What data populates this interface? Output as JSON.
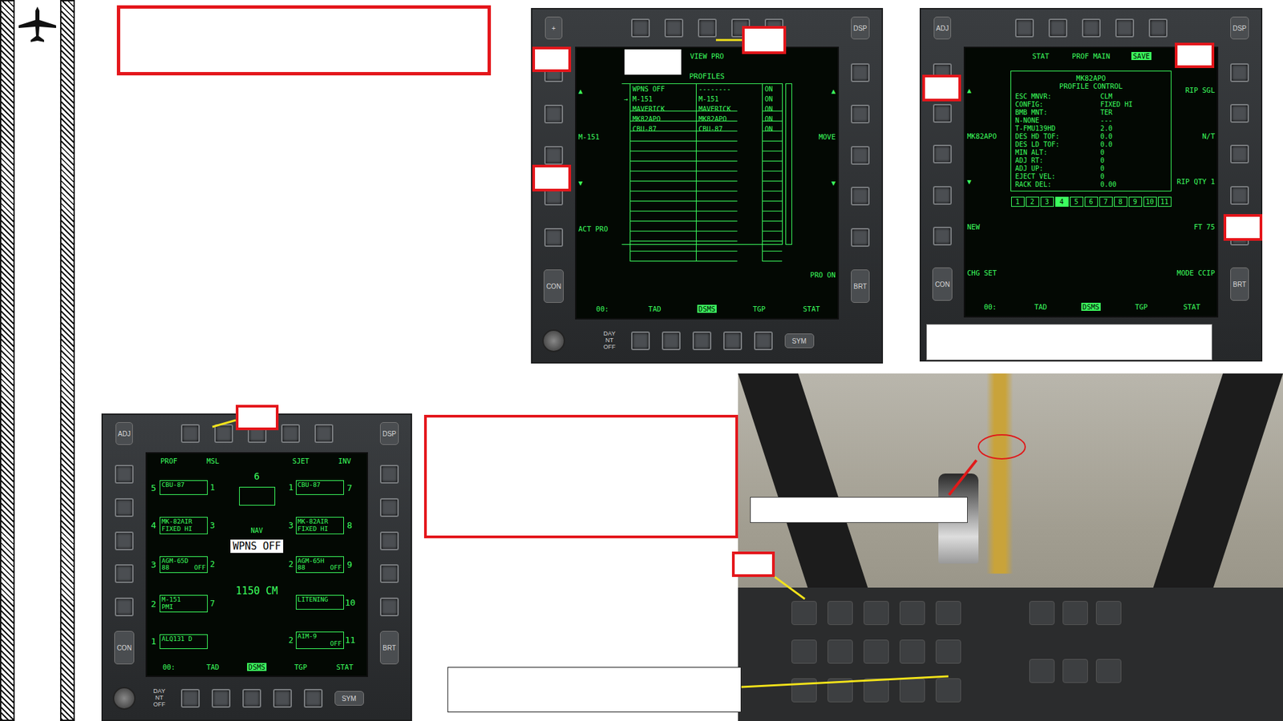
{
  "profiles_page": {
    "bezel": {
      "adj": "+",
      "dsp": "DSP",
      "con": "CON",
      "brt": "BRT",
      "day": "DAY NT OFF",
      "sym": "SYM"
    },
    "top": [
      {
        "text": "",
        "selected": false
      },
      {
        "text": "",
        "selected": false
      },
      {
        "text": "VIEW PRO",
        "selected": false
      },
      {
        "text": "",
        "selected": false
      },
      {
        "text": "",
        "selected": false
      }
    ],
    "left": [
      "▲",
      "M-151",
      "▼",
      "ACT PRO",
      ""
    ],
    "right": [
      "▲",
      "MOVE",
      "▼",
      "",
      "PRO ON"
    ],
    "bottom": [
      {
        "text": "00:",
        "selected": false
      },
      {
        "text": "TAD",
        "selected": false
      },
      {
        "text": "DSMS",
        "selected": true
      },
      {
        "text": "TGP",
        "selected": false
      },
      {
        "text": "STAT",
        "selected": false
      }
    ],
    "table": {
      "title": "PROFILES",
      "marker": "→",
      "rows": [
        {
          "cells": [
            "WPNS OFF",
            "--------",
            "ON"
          ],
          "selected": false
        },
        {
          "cells": [
            "M-151",
            "M-151",
            "ON"
          ],
          "selected": true
        },
        {
          "cells": [
            "MAVERICK",
            "MAVERICK",
            "ON"
          ],
          "selected": false
        },
        {
          "cells": [
            "MK82APO",
            "MK82APO",
            "ON"
          ],
          "selected": false
        },
        {
          "cells": [
            "CBU-87",
            "CBU-87",
            "ON"
          ],
          "selected": false
        },
        {
          "cells": [
            "",
            "",
            ""
          ],
          "selected": false
        },
        {
          "cells": [
            "",
            "",
            ""
          ],
          "selected": false
        },
        {
          "cells": [
            "",
            "",
            ""
          ],
          "selected": false
        },
        {
          "cells": [
            "",
            "",
            ""
          ],
          "selected": false
        },
        {
          "cells": [
            "",
            "",
            ""
          ],
          "selected": false
        },
        {
          "cells": [
            "",
            "",
            ""
          ],
          "selected": false
        },
        {
          "cells": [
            "",
            "",
            ""
          ],
          "selected": false
        },
        {
          "cells": [
            "",
            "",
            ""
          ],
          "selected": false
        },
        {
          "cells": [
            "",
            "",
            ""
          ],
          "selected": false
        },
        {
          "cells": [
            "",
            "",
            ""
          ],
          "selected": false
        },
        {
          "cells": [
            "",
            "",
            ""
          ],
          "selected": false
        }
      ]
    }
  },
  "profile_control_page": {
    "bezel": {
      "adj": "ADJ",
      "dsp": "DSP",
      "con": "CON",
      "brt": "BRT"
    },
    "top": [
      {
        "text": "",
        "selected": false
      },
      {
        "text": "STAT",
        "selected": false
      },
      {
        "text": "PROF MAIN",
        "selected": false
      },
      {
        "text": "SAVE",
        "selected": true
      },
      {
        "text": "",
        "selected": false
      }
    ],
    "left": [
      "▲",
      "MK82APO",
      "▼",
      "NEW",
      "CHG SET"
    ],
    "right": [
      "RIP SGL",
      "N/T",
      "RIP QTY 1",
      "FT 75",
      "MODE CCIP"
    ],
    "bottom": [
      {
        "text": "00:",
        "selected": false
      },
      {
        "text": "TAD",
        "selected": false
      },
      {
        "text": "DSMS",
        "selected": true
      },
      {
        "text": "TGP",
        "selected": false
      },
      {
        "text": "STAT",
        "selected": false
      }
    ],
    "title": "MK82APO",
    "subtitle": "PROFILE CONTROL",
    "fields": [
      {
        "label": "ESC MNVR:",
        "value": "CLM"
      },
      {
        "label": "CONFIG:",
        "value": "FIXED HI"
      },
      {
        "label": "BMB MNT:",
        "value": "TER"
      },
      {
        "label": "N-NONE",
        "value": "---"
      },
      {
        "label": "T-FMU139HD",
        "value": "2.0"
      },
      {
        "label": "DES HD TOF:",
        "value": "0.0"
      },
      {
        "label": "DES LD TOF:",
        "value": "0.0"
      },
      {
        "label": "MIN ALT:",
        "value": "0"
      },
      {
        "label": "ADJ RT:",
        "value": "0"
      },
      {
        "label": "ADJ UP:",
        "value": "0"
      },
      {
        "label": "EJECT VEL:",
        "value": "0"
      },
      {
        "label": "RACK DEL:",
        "value": "0.00"
      }
    ],
    "stations": [
      {
        "text": "1",
        "selected": false
      },
      {
        "text": "2",
        "selected": false
      },
      {
        "text": "3",
        "selected": false
      },
      {
        "text": "4",
        "selected": true
      },
      {
        "text": "5",
        "selected": false
      },
      {
        "text": "6",
        "selected": false
      },
      {
        "text": "7",
        "selected": false
      },
      {
        "text": "8",
        "selected": false
      },
      {
        "text": "9",
        "selected": false
      },
      {
        "text": "10",
        "selected": false
      },
      {
        "text": "11",
        "selected": false
      }
    ]
  },
  "dsms_status_page": {
    "bezel": {
      "adj": "ADJ",
      "dsp": "DSP",
      "con": "CON",
      "brt": "BRT",
      "day": "DAY NT OFF",
      "sym": "SYM"
    },
    "top": [
      {
        "text": "PROF",
        "selected": false
      },
      {
        "text": "MSL",
        "selected": false
      },
      {
        "text": "",
        "selected": false
      },
      {
        "text": "SJET",
        "selected": false
      },
      {
        "text": "INV",
        "selected": false
      }
    ],
    "bottom": [
      {
        "text": "00:",
        "selected": false
      },
      {
        "text": "TAD",
        "selected": false
      },
      {
        "text": "DSMS",
        "selected": true
      },
      {
        "text": "TGP",
        "selected": false
      },
      {
        "text": "STAT",
        "selected": false
      }
    ],
    "center_station": "6",
    "mode": "NAV",
    "master": "WPNS OFF",
    "countermeasures": "1150 CM",
    "left_stations": [
      {
        "num": "5",
        "lines": [
          "CBU-87"
        ],
        "sub": "",
        "status": "",
        "qty": "1"
      },
      {
        "num": "4",
        "lines": [
          "MK-82AIR"
        ],
        "sub": "FIXED HI",
        "status": "",
        "qty": "3"
      },
      {
        "num": "3",
        "lines": [
          "AGM-65D"
        ],
        "sub": "88",
        "status": "OFF",
        "qty": "2"
      },
      {
        "num": "2",
        "lines": [
          "M-151"
        ],
        "sub": "PMI",
        "status": "",
        "qty": "7"
      },
      {
        "num": "1",
        "lines": [
          "ALQ131 D"
        ],
        "sub": "",
        "status": "",
        "qty": ""
      }
    ],
    "right_stations": [
      {
        "num": "7",
        "lines": [
          "CBU-87"
        ],
        "sub": "",
        "status": "",
        "qty": "1"
      },
      {
        "num": "8",
        "lines": [
          "MK-82AIR"
        ],
        "sub": "FIXED HI",
        "status": "",
        "qty": "3"
      },
      {
        "num": "9",
        "lines": [
          "AGM-65H"
        ],
        "sub": "88",
        "status": "OFF",
        "qty": "2"
      },
      {
        "num": "10",
        "lines": [
          "LITENING"
        ],
        "sub": "",
        "status": "",
        "qty": ""
      },
      {
        "num": "11",
        "lines": [
          "AIM-9"
        ],
        "sub": "",
        "status": "OFF",
        "qty": "2"
      }
    ]
  }
}
